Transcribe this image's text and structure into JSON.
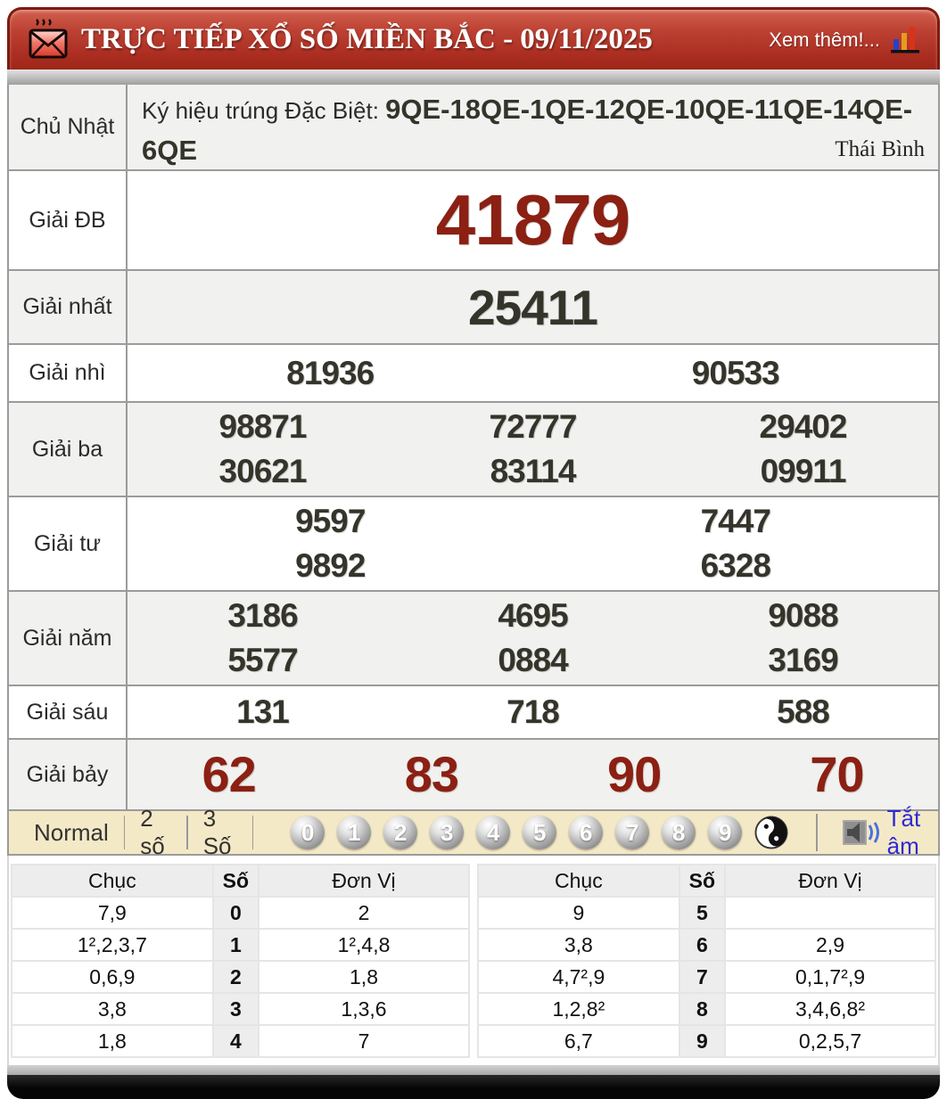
{
  "header": {
    "title": "TRỰC TIẾP XỔ SỐ MIỀN BẮC - 09/11/2025",
    "more_link": "Xem thêm!..."
  },
  "info_row": {
    "day": "Chủ Nhật",
    "sign_label": "Ký hiệu trúng Đặc Biệt: ",
    "sign_codes": "9QE-18QE-1QE-12QE-10QE-11QE-14QE-6QE",
    "province": "Thái Bình"
  },
  "results": {
    "rows": [
      {
        "label": "Giải ĐB",
        "lines": [
          [
            "41879"
          ]
        ]
      },
      {
        "label": "Giải nhất",
        "lines": [
          [
            "25411"
          ]
        ]
      },
      {
        "label": "Giải nhì",
        "lines": [
          [
            "81936",
            "90533"
          ]
        ]
      },
      {
        "label": "Giải ba",
        "lines": [
          [
            "98871",
            "72777",
            "29402"
          ],
          [
            "30621",
            "83114",
            "09911"
          ]
        ]
      },
      {
        "label": "Giải tư",
        "lines": [
          [
            "9597",
            "7447"
          ],
          [
            "9892",
            "6328"
          ]
        ]
      },
      {
        "label": "Giải năm",
        "lines": [
          [
            "3186",
            "4695",
            "9088"
          ],
          [
            "5577",
            "0884",
            "3169"
          ]
        ]
      },
      {
        "label": "Giải sáu",
        "lines": [
          [
            "131",
            "718",
            "588"
          ]
        ]
      },
      {
        "label": "Giải bảy",
        "lines": [
          [
            "62",
            "83",
            "90",
            "70"
          ]
        ]
      }
    ]
  },
  "controls": {
    "modes": [
      "Normal",
      "2 số",
      "3 Số"
    ],
    "balls": [
      "0",
      "1",
      "2",
      "3",
      "4",
      "5",
      "6",
      "7",
      "8",
      "9"
    ],
    "mute_label": "Tắt âm"
  },
  "digit_tables": {
    "headers": [
      "Chục",
      "Số",
      "Đơn Vị"
    ],
    "left": [
      {
        "chuc": "7,9",
        "so": "0",
        "donvi": "2"
      },
      {
        "chuc": "1²,2,3,7",
        "so": "1",
        "donvi": "1²,4,8"
      },
      {
        "chuc": "0,6,9",
        "so": "2",
        "donvi": "1,8"
      },
      {
        "chuc": "3,8",
        "so": "3",
        "donvi": "1,3,6"
      },
      {
        "chuc": "1,8",
        "so": "4",
        "donvi": "7"
      }
    ],
    "right": [
      {
        "chuc": "9",
        "so": "5",
        "donvi": ""
      },
      {
        "chuc": "3,8",
        "so": "6",
        "donvi": "2,9"
      },
      {
        "chuc": "4,7²,9",
        "so": "7",
        "donvi": "0,1,7²,9"
      },
      {
        "chuc": "1,2,8²",
        "so": "8",
        "donvi": "3,4,6,8²"
      },
      {
        "chuc": "6,7",
        "so": "9",
        "donvi": "0,2,5,7"
      }
    ]
  },
  "colors": {
    "header_red": "#ab2e21",
    "special_red": "#8b2013",
    "number_dark": "#34342b",
    "control_cream": "#f4e9c6",
    "link_blue": "#2b2bd6"
  }
}
